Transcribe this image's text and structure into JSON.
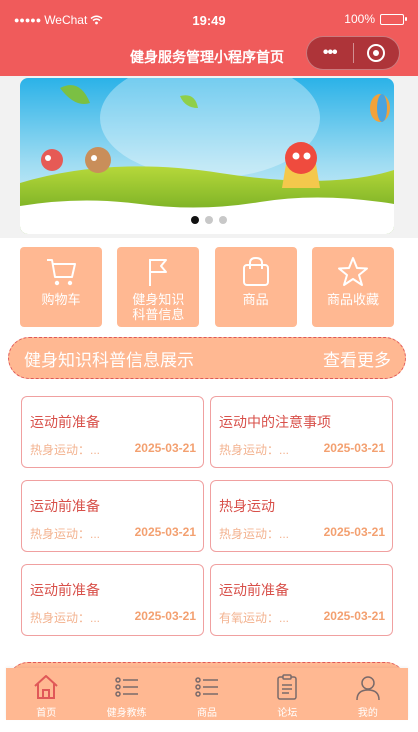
{
  "status_bar": {
    "signal": "●●●●●",
    "carrier": "WeChat",
    "time": "19:49",
    "battery": "100%"
  },
  "nav": {
    "title": "健身服务管理小程序首页",
    "more_icon": "ellipsis-icon",
    "close_icon": "target-icon"
  },
  "banner": {
    "slides": 3,
    "active_slide": 1
  },
  "categories": [
    {
      "label": "购物车",
      "icon": "cart-icon"
    },
    {
      "label": "健身知识\n科普信息",
      "icon": "flag-icon"
    },
    {
      "label": "商品",
      "icon": "bag-icon"
    },
    {
      "label": "商品收藏",
      "icon": "star-icon"
    }
  ],
  "section": {
    "title": "健身知识科普信息展示",
    "more": "查看更多"
  },
  "cards": [
    {
      "title": "运动前准备",
      "sub": "热身运动：...",
      "date": "2025-03-21"
    },
    {
      "title": "运动中的注意事项",
      "sub": "热身运动：...",
      "date": "2025-03-21"
    },
    {
      "title": "运动前准备",
      "sub": "热身运动：...",
      "date": "2025-03-21"
    },
    {
      "title": "热身运动",
      "sub": "热身运动：...",
      "date": "2025-03-21"
    },
    {
      "title": "运动前准备",
      "sub": "热身运动：...",
      "date": "2025-03-21"
    },
    {
      "title": "运动前准备",
      "sub": "有氧运动：...",
      "date": "2025-03-21"
    }
  ],
  "tabbar": [
    {
      "label": "首页",
      "icon": "home-icon",
      "active": true
    },
    {
      "label": "健身教练",
      "icon": "list-icon"
    },
    {
      "label": "商品",
      "icon": "list-icon"
    },
    {
      "label": "论坛",
      "icon": "clipboard-icon"
    },
    {
      "label": "我的",
      "icon": "user-icon"
    }
  ],
  "colors": {
    "primary": "#f05b5b",
    "accent": "#ffb892",
    "card_title": "#d8504a",
    "card_border": "#f0a0a0"
  }
}
